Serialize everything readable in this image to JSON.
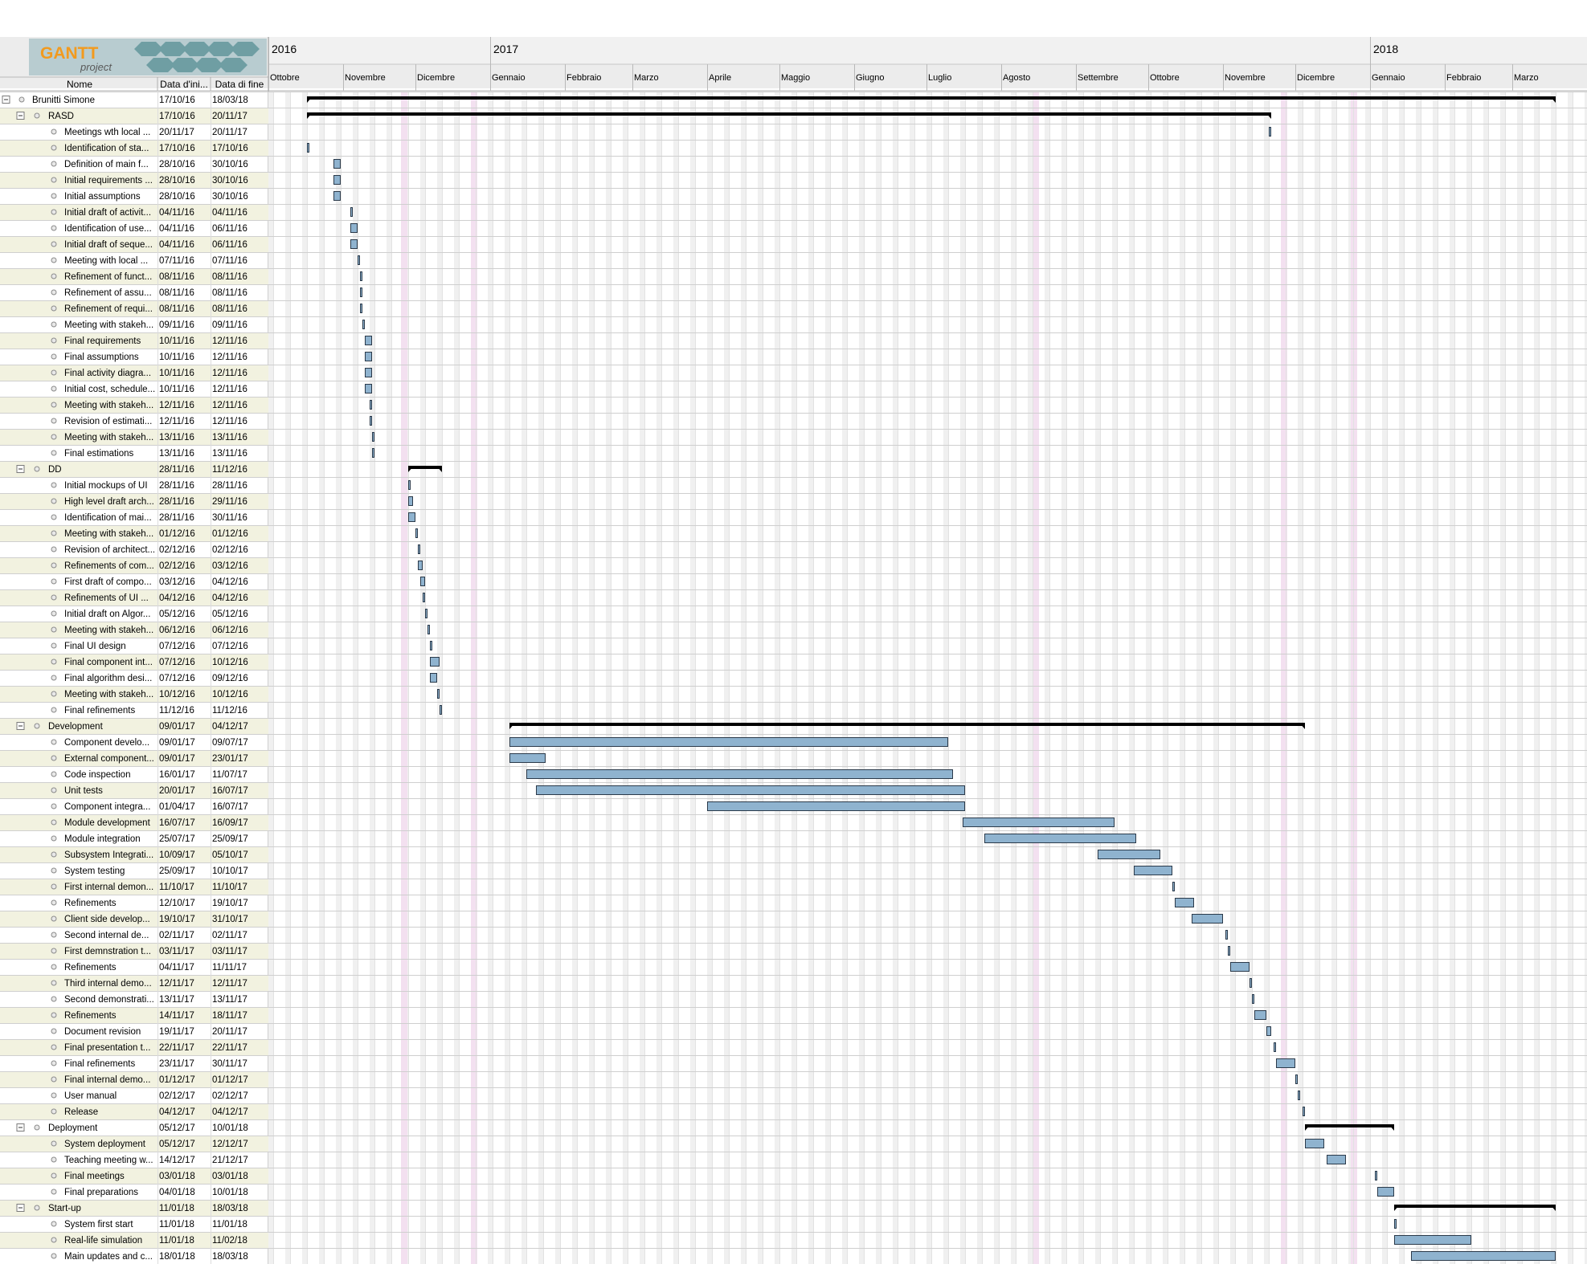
{
  "logo": {
    "line1": "GANTT",
    "line2": "project"
  },
  "columns": {
    "name": "Nome",
    "start": "Data d'ini...",
    "end": "Data di fine"
  },
  "timeline": {
    "years": [
      {
        "label": "2016",
        "date": "2016-10-01"
      },
      {
        "label": "2017",
        "date": "2017-01-01"
      },
      {
        "label": "2018",
        "date": "2018-01-01"
      }
    ],
    "months": [
      {
        "label": "Ottobre",
        "date": "2016-10-01"
      },
      {
        "label": "Novembre",
        "date": "2016-11-01"
      },
      {
        "label": "Dicembre",
        "date": "2016-12-01"
      },
      {
        "label": "Gennaio",
        "date": "2017-01-01"
      },
      {
        "label": "Febbraio",
        "date": "2017-02-01"
      },
      {
        "label": "Marzo",
        "date": "2017-03-01"
      },
      {
        "label": "Aprile",
        "date": "2017-04-01"
      },
      {
        "label": "Maggio",
        "date": "2017-05-01"
      },
      {
        "label": "Giugno",
        "date": "2017-06-01"
      },
      {
        "label": "Luglio",
        "date": "2017-07-01"
      },
      {
        "label": "Agosto",
        "date": "2017-08-01"
      },
      {
        "label": "Settembre",
        "date": "2017-09-01"
      },
      {
        "label": "Ottobre",
        "date": "2017-10-01"
      },
      {
        "label": "Novembre",
        "date": "2017-11-01"
      },
      {
        "label": "Dicembre",
        "date": "2017-12-01"
      },
      {
        "label": "Gennaio",
        "date": "2018-01-01"
      },
      {
        "label": "Febbraio",
        "date": "2018-02-01"
      },
      {
        "label": "Marzo",
        "date": "2018-03-01"
      }
    ],
    "range": [
      "2016-10-01",
      "2018-03-31"
    ]
  },
  "colors": {
    "task_fill": "#8fb3cf",
    "task_stroke": "#2b3a4a",
    "summary": "#000000",
    "stripe": "#f2f2e0",
    "holiday": "#f3e0f0"
  },
  "chart_data": {
    "type": "gantt",
    "tasks": [
      {
        "name": "Brunitti Simone",
        "start": "17/10/16",
        "end": "18/03/18",
        "level": 0,
        "summary": true
      },
      {
        "name": "RASD",
        "start": "17/10/16",
        "end": "20/11/17",
        "level": 1,
        "summary": true
      },
      {
        "name": "Meetings wth local ...",
        "start": "20/11/17",
        "end": "20/11/17",
        "level": 2
      },
      {
        "name": "Identification of sta...",
        "start": "17/10/16",
        "end": "17/10/16",
        "level": 2
      },
      {
        "name": "Definition of main f...",
        "start": "28/10/16",
        "end": "30/10/16",
        "level": 2
      },
      {
        "name": "Initial requirements ...",
        "start": "28/10/16",
        "end": "30/10/16",
        "level": 2
      },
      {
        "name": "Initial assumptions",
        "start": "28/10/16",
        "end": "30/10/16",
        "level": 2
      },
      {
        "name": "Initial draft of activit...",
        "start": "04/11/16",
        "end": "04/11/16",
        "level": 2
      },
      {
        "name": "Identification of use...",
        "start": "04/11/16",
        "end": "06/11/16",
        "level": 2
      },
      {
        "name": "Initial draft of seque...",
        "start": "04/11/16",
        "end": "06/11/16",
        "level": 2
      },
      {
        "name": "Meeting with local ...",
        "start": "07/11/16",
        "end": "07/11/16",
        "level": 2
      },
      {
        "name": "Refinement of funct...",
        "start": "08/11/16",
        "end": "08/11/16",
        "level": 2
      },
      {
        "name": "Refinement of assu...",
        "start": "08/11/16",
        "end": "08/11/16",
        "level": 2
      },
      {
        "name": "Refinement of requi...",
        "start": "08/11/16",
        "end": "08/11/16",
        "level": 2
      },
      {
        "name": "Meeting with stakeh...",
        "start": "09/11/16",
        "end": "09/11/16",
        "level": 2
      },
      {
        "name": "Final requirements",
        "start": "10/11/16",
        "end": "12/11/16",
        "level": 2
      },
      {
        "name": "Final assumptions",
        "start": "10/11/16",
        "end": "12/11/16",
        "level": 2
      },
      {
        "name": "Final activity diagra...",
        "start": "10/11/16",
        "end": "12/11/16",
        "level": 2
      },
      {
        "name": "Initial cost, schedule...",
        "start": "10/11/16",
        "end": "12/11/16",
        "level": 2
      },
      {
        "name": "Meeting with stakeh...",
        "start": "12/11/16",
        "end": "12/11/16",
        "level": 2
      },
      {
        "name": "Revision of estimati...",
        "start": "12/11/16",
        "end": "12/11/16",
        "level": 2
      },
      {
        "name": "Meeting with stakeh...",
        "start": "13/11/16",
        "end": "13/11/16",
        "level": 2
      },
      {
        "name": "Final estimations",
        "start": "13/11/16",
        "end": "13/11/16",
        "level": 2
      },
      {
        "name": "DD",
        "start": "28/11/16",
        "end": "11/12/16",
        "level": 1,
        "summary": true
      },
      {
        "name": "Initial mockups of UI",
        "start": "28/11/16",
        "end": "28/11/16",
        "level": 2
      },
      {
        "name": "High level draft arch...",
        "start": "28/11/16",
        "end": "29/11/16",
        "level": 2
      },
      {
        "name": "Identification of mai...",
        "start": "28/11/16",
        "end": "30/11/16",
        "level": 2
      },
      {
        "name": "Meeting with stakeh...",
        "start": "01/12/16",
        "end": "01/12/16",
        "level": 2
      },
      {
        "name": "Revision of architect...",
        "start": "02/12/16",
        "end": "02/12/16",
        "level": 2
      },
      {
        "name": "Refinements of com...",
        "start": "02/12/16",
        "end": "03/12/16",
        "level": 2
      },
      {
        "name": "First draft of compo...",
        "start": "03/12/16",
        "end": "04/12/16",
        "level": 2
      },
      {
        "name": "Refinements of UI ...",
        "start": "04/12/16",
        "end": "04/12/16",
        "level": 2
      },
      {
        "name": "Initial draft on Algor...",
        "start": "05/12/16",
        "end": "05/12/16",
        "level": 2
      },
      {
        "name": "Meeting with stakeh...",
        "start": "06/12/16",
        "end": "06/12/16",
        "level": 2
      },
      {
        "name": "Final UI design",
        "start": "07/12/16",
        "end": "07/12/16",
        "level": 2
      },
      {
        "name": "Final component int...",
        "start": "07/12/16",
        "end": "10/12/16",
        "level": 2
      },
      {
        "name": "Final algorithm desi...",
        "start": "07/12/16",
        "end": "09/12/16",
        "level": 2
      },
      {
        "name": "Meeting with stakeh...",
        "start": "10/12/16",
        "end": "10/12/16",
        "level": 2
      },
      {
        "name": "Final refinements",
        "start": "11/12/16",
        "end": "11/12/16",
        "level": 2
      },
      {
        "name": "Development",
        "start": "09/01/17",
        "end": "04/12/17",
        "level": 1,
        "summary": true
      },
      {
        "name": "Component develo...",
        "start": "09/01/17",
        "end": "09/07/17",
        "level": 2
      },
      {
        "name": "External component...",
        "start": "09/01/17",
        "end": "23/01/17",
        "level": 2
      },
      {
        "name": "Code inspection",
        "start": "16/01/17",
        "end": "11/07/17",
        "level": 2
      },
      {
        "name": "Unit tests",
        "start": "20/01/17",
        "end": "16/07/17",
        "level": 2
      },
      {
        "name": "Component integra...",
        "start": "01/04/17",
        "end": "16/07/17",
        "level": 2
      },
      {
        "name": "Module development",
        "start": "16/07/17",
        "end": "16/09/17",
        "level": 2
      },
      {
        "name": "Module integration",
        "start": "25/07/17",
        "end": "25/09/17",
        "level": 2
      },
      {
        "name": "Subsystem Integrati...",
        "start": "10/09/17",
        "end": "05/10/17",
        "level": 2
      },
      {
        "name": "System testing",
        "start": "25/09/17",
        "end": "10/10/17",
        "level": 2
      },
      {
        "name": "First internal demon...",
        "start": "11/10/17",
        "end": "11/10/17",
        "level": 2
      },
      {
        "name": "Refinements",
        "start": "12/10/17",
        "end": "19/10/17",
        "level": 2
      },
      {
        "name": "Client side develop...",
        "start": "19/10/17",
        "end": "31/10/17",
        "level": 2
      },
      {
        "name": "Second internal de...",
        "start": "02/11/17",
        "end": "02/11/17",
        "level": 2
      },
      {
        "name": "First demnstration t...",
        "start": "03/11/17",
        "end": "03/11/17",
        "level": 2
      },
      {
        "name": "Refinements",
        "start": "04/11/17",
        "end": "11/11/17",
        "level": 2
      },
      {
        "name": "Third internal demo...",
        "start": "12/11/17",
        "end": "12/11/17",
        "level": 2
      },
      {
        "name": "Second demonstrati...",
        "start": "13/11/17",
        "end": "13/11/17",
        "level": 2
      },
      {
        "name": "Refinements",
        "start": "14/11/17",
        "end": "18/11/17",
        "level": 2
      },
      {
        "name": "Document revision",
        "start": "19/11/17",
        "end": "20/11/17",
        "level": 2
      },
      {
        "name": "Final presentation t...",
        "start": "22/11/17",
        "end": "22/11/17",
        "level": 2
      },
      {
        "name": "Final refinements",
        "start": "23/11/17",
        "end": "30/11/17",
        "level": 2
      },
      {
        "name": "Final internal demo...",
        "start": "01/12/17",
        "end": "01/12/17",
        "level": 2
      },
      {
        "name": "User manual",
        "start": "02/12/17",
        "end": "02/12/17",
        "level": 2
      },
      {
        "name": "Release",
        "start": "04/12/17",
        "end": "04/12/17",
        "level": 2
      },
      {
        "name": "Deployment",
        "start": "05/12/17",
        "end": "10/01/18",
        "level": 1,
        "summary": true
      },
      {
        "name": "System deployment",
        "start": "05/12/17",
        "end": "12/12/17",
        "level": 2
      },
      {
        "name": "Teaching meeting w...",
        "start": "14/12/17",
        "end": "21/12/17",
        "level": 2
      },
      {
        "name": "Final meetings",
        "start": "03/01/18",
        "end": "03/01/18",
        "level": 2
      },
      {
        "name": "Final preparations",
        "start": "04/01/18",
        "end": "10/01/18",
        "level": 2
      },
      {
        "name": "Start-up",
        "start": "11/01/18",
        "end": "18/03/18",
        "level": 1,
        "summary": true
      },
      {
        "name": "System first start",
        "start": "11/01/18",
        "end": "11/01/18",
        "level": 2
      },
      {
        "name": "Real-life simulation",
        "start": "11/01/18",
        "end": "11/02/18",
        "level": 2
      },
      {
        "name": "Main updates and c...",
        "start": "18/01/18",
        "end": "18/03/18",
        "level": 2
      }
    ]
  }
}
